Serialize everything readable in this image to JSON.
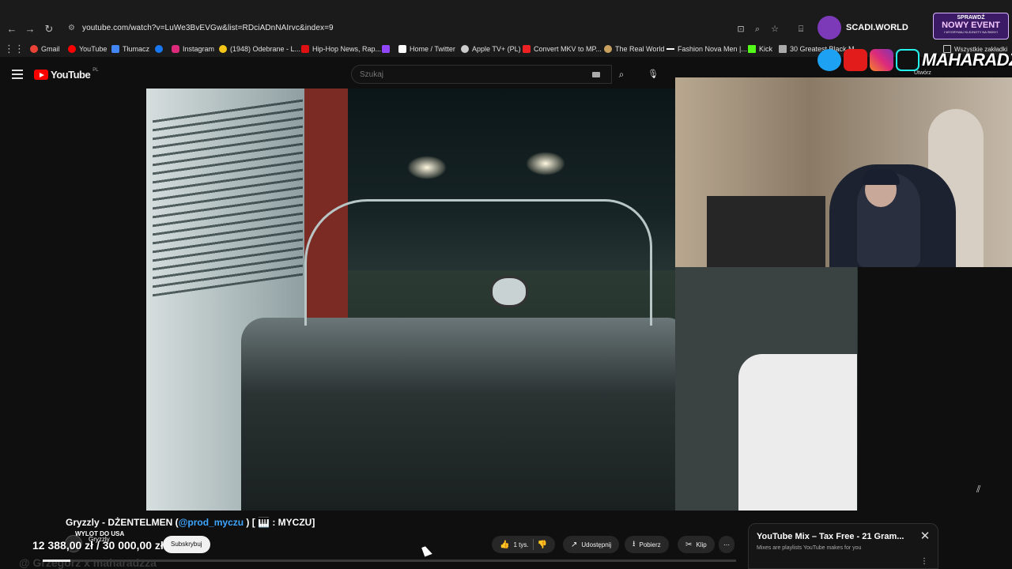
{
  "browser": {
    "url": "youtube.com/watch?v=LuWe3BvEVGw&list=RDciADnNAIrvc&index=9",
    "bookmarks": [
      {
        "label": "Gmail",
        "color": "#ea4335"
      },
      {
        "label": "YouTube",
        "color": "#ff0000"
      },
      {
        "label": "Tłumacz",
        "color": "#4285f4"
      },
      {
        "label": "",
        "color": "#1877f2"
      },
      {
        "label": "Instagram",
        "color": "#dd2a7b"
      },
      {
        "label": "(1948) Odebrane - L...",
        "color": "#f5c518"
      },
      {
        "label": "Hip-Hop News, Rap...",
        "color": "#d11"
      },
      {
        "label": "",
        "color": "#9146ff"
      },
      {
        "label": "Home / Twitter",
        "color": "#ffffff"
      },
      {
        "label": "Apple TV+ (PL)",
        "color": "#cccccc"
      },
      {
        "label": "Convert MKV to MP...",
        "color": "#e22"
      },
      {
        "label": "The Real World",
        "color": "#c8a060"
      },
      {
        "label": "Fashion Nova Men |...",
        "color": "#ffffff"
      },
      {
        "label": "Kick",
        "color": "#53fc18"
      },
      {
        "label": "30 Greatest Black M...",
        "color": "#aaaaaa"
      }
    ],
    "all_bookmarks": "Wszystkie zakładki"
  },
  "youtube": {
    "logo_text": "YouTube",
    "logo_region": "PL",
    "search_placeholder": "Szukaj",
    "create_label": "Utwórz"
  },
  "overlay": {
    "brand": "SCADI.WORLD",
    "event_line1": "SPRAWDŹ",
    "event_line2": "NOWY EVENT",
    "event_line3": "I WYGRYWAJ KLEJNOTY NA SKINY!",
    "handle": "MAHARADZZA"
  },
  "video": {
    "title_prefix": "Gryzzly - DŻENTELMEN (",
    "title_link": "@prod_myczu",
    "title_suffix": " ) [ 🎹 : MYCZU]",
    "channel": "Gryzzly",
    "donation": "12 388,00 zł / 30 000,00 zł",
    "donation_goal_label": "WYLOT DO USA",
    "subscribe": "Subskrybuj",
    "likes": "1 tys.",
    "share": "Udostępnij",
    "download": "Pobierz",
    "clip": "Klip",
    "more": "⋯",
    "faded_text": "@ Grzegorz x maharadzza",
    "progress_fraction": 0.04
  },
  "mix": {
    "title": "YouTube Mix – Tax Free - 21 Gram...",
    "subtitle": "Mixes are playlists YouTube makes for you"
  }
}
